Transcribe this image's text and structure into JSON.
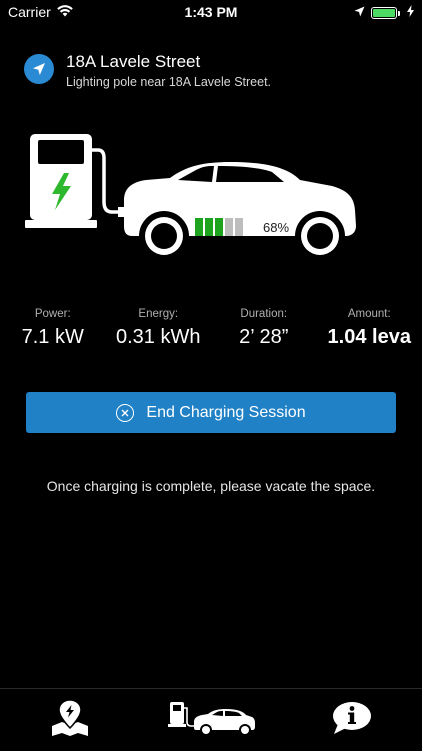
{
  "status_bar": {
    "carrier": "Carrier",
    "time": "1:43 PM"
  },
  "location": {
    "title": "18A Lavele Street",
    "subtitle": "Lighting pole near 18A Lavele Street.",
    "icon": "location-arrow-icon"
  },
  "illustration": {
    "battery_percent_label": "68%",
    "battery_level": 0.68,
    "colors": {
      "bolt": "#2eb82e",
      "battery_on": "#1ea31e",
      "battery_off": "#bdbdbd"
    }
  },
  "stats": [
    {
      "label": "Power:",
      "value": "7.1 kW"
    },
    {
      "label": "Energy:",
      "value": "0.31 kWh"
    },
    {
      "label": "Duration:",
      "value": "2’ 28”"
    },
    {
      "label": "Amount:",
      "value": "1.04 leva"
    }
  ],
  "action": {
    "end_label": "End Charging Session",
    "color": "#2081c6"
  },
  "notice": "Once charging is complete, please vacate the space.",
  "tabs": [
    {
      "name": "map",
      "icon": "map-pin-icon"
    },
    {
      "name": "charging",
      "icon": "charging-car-icon",
      "selected": true
    },
    {
      "name": "info",
      "icon": "info-bubble-icon"
    }
  ]
}
